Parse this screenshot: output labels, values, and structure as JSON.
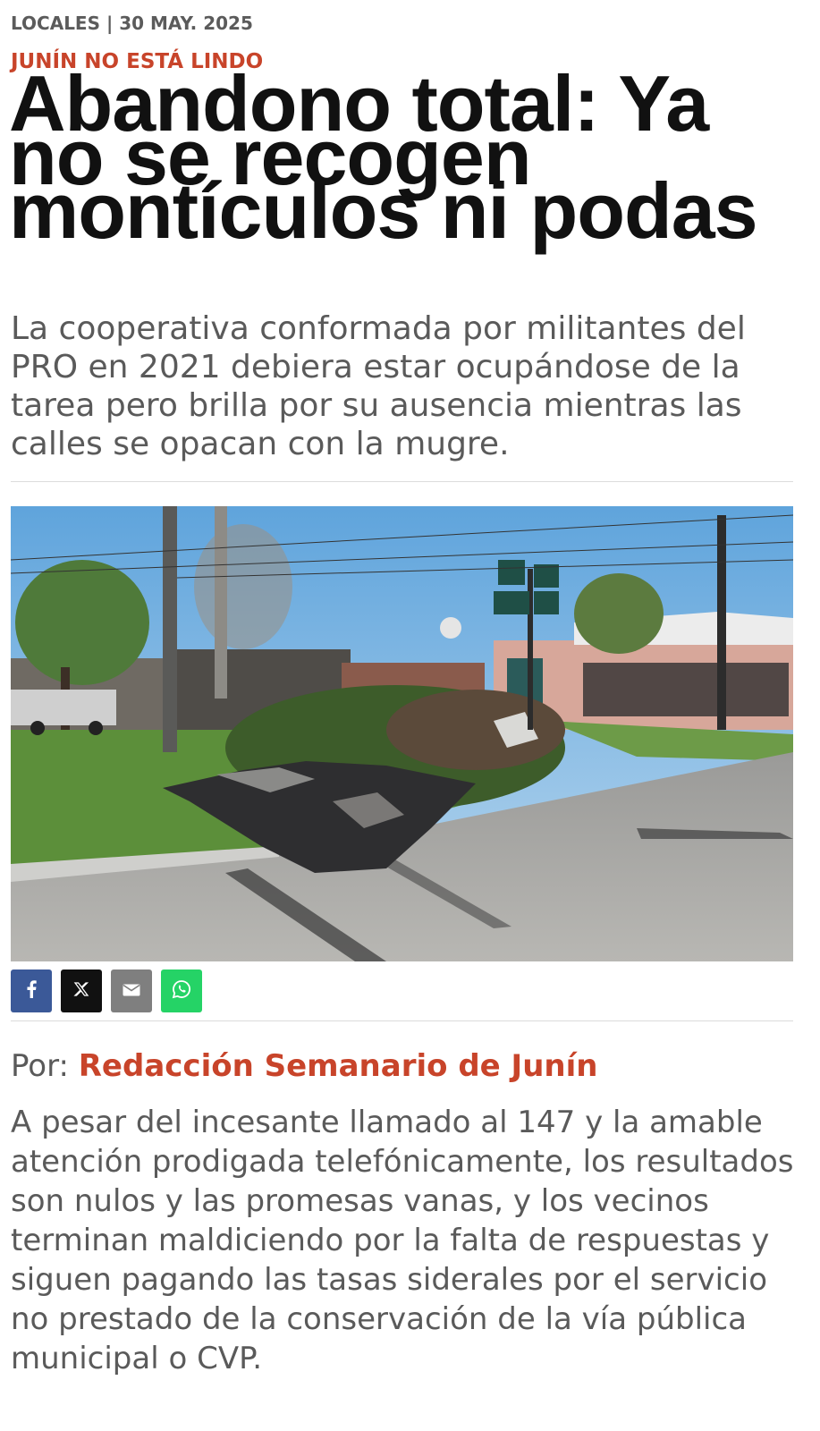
{
  "article": {
    "section_date": "LOCALES | 30 MAY. 2025",
    "kicker": "JUNÍN NO ESTÁ LINDO",
    "headline": "Abandono total: Ya no se recogen montículos ni podas",
    "lead": "La cooperativa conformada por militantes del PRO en 2021 debiera estar ocupándose de la tarea pero brilla por su ausencia mientras las calles se opacan con la mugre.",
    "byline_prefix": "Por:",
    "author": "Redacción Semanario de Junín",
    "body": "A pesar del incesante llamado al 147 y la amable atención prodigada telefónicamente, los resultados son nulos y las promesas vanas, y los vecinos terminan maldiciendo por la falta de respuestas y siguen pagando las tasas siderales por el servicio no prestado de la conservación de la vía pública municipal o CVP."
  },
  "share": {
    "buttons": [
      {
        "icon": "facebook-icon",
        "color": "#3b5998"
      },
      {
        "icon": "x-twitter-icon",
        "color": "#111111"
      },
      {
        "icon": "email-icon",
        "color": "#7f7f7f"
      },
      {
        "icon": "whatsapp-icon",
        "color": "#25d366"
      }
    ]
  },
  "colors": {
    "accent": "#c8442a",
    "headline": "#111111",
    "text": "#5a5a5a"
  }
}
